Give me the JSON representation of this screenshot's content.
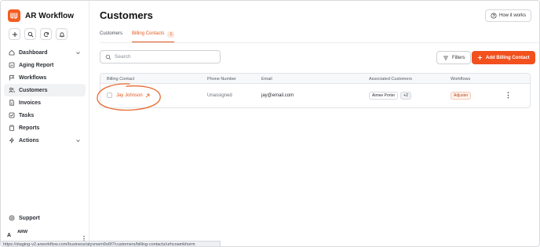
{
  "app": {
    "name": "AR Workflow"
  },
  "sidebar": {
    "quick_actions": [
      {
        "icon": "plus-icon"
      },
      {
        "icon": "search-icon"
      },
      {
        "icon": "refresh-icon"
      },
      {
        "icon": "bell-icon"
      }
    ],
    "items": [
      {
        "label": "Dashboard",
        "icon": "home-icon",
        "has_chevron": true
      },
      {
        "label": "Aging Report",
        "icon": "report-icon"
      },
      {
        "label": "Workflows",
        "icon": "flag-icon"
      },
      {
        "label": "Customers",
        "icon": "users-icon",
        "active": true
      },
      {
        "label": "Invoices",
        "icon": "invoice-icon"
      },
      {
        "label": "Tasks",
        "icon": "tasks-icon"
      },
      {
        "label": "Reports",
        "icon": "clipboard-icon"
      },
      {
        "label": "Actions",
        "icon": "bolt-icon",
        "has_chevron": true
      }
    ],
    "support_label": "Support",
    "user": {
      "initial": "A",
      "name": "ARW"
    }
  },
  "status_url": "https://staging-v2.arworkflow.com/business/atyvnwm9o6f7/customers/billing-contacts/urhcoamkhorm",
  "page": {
    "title": "Customers",
    "how_it_works": "How it works",
    "tabs": [
      {
        "label": "Customers",
        "active": false
      },
      {
        "label": "Billing Contacts",
        "active": true,
        "badge": "1"
      }
    ],
    "search_placeholder": "Search",
    "filters_label": "Filters",
    "add_button": "Add Billing Contact"
  },
  "table": {
    "columns": [
      "Billing Contact",
      "Phone Number",
      "Email",
      "Associated Customers",
      "Workflows"
    ],
    "rows": [
      {
        "contact": "Jay Johnson",
        "phone": "Unassigned",
        "email": "jay@email.com",
        "customers": [
          "Aimee Porter",
          "+2"
        ],
        "workflow": "Adjuster"
      }
    ]
  },
  "colors": {
    "accent": "#f2501d",
    "annotation_circle": "#e8692f"
  }
}
